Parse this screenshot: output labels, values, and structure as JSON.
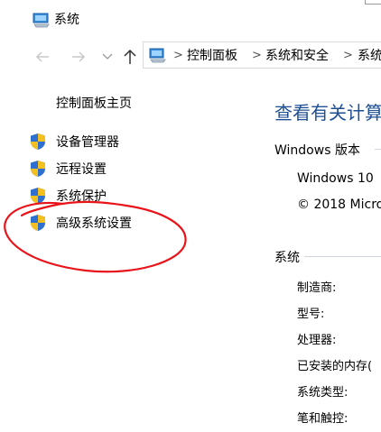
{
  "window": {
    "title": "系统"
  },
  "nav": {
    "back_icon": "arrow-left-icon",
    "forward_icon": "arrow-right-icon",
    "up_icon": "arrow-up-icon",
    "recent_icon": "chevron-down-icon"
  },
  "breadcrumb": {
    "items": [
      "控制面板",
      "系统和安全",
      "系统"
    ],
    "separator": ">"
  },
  "sidebar": {
    "home": "控制面板主页",
    "links": [
      "设备管理器",
      "远程设置",
      "系统保护",
      "高级系统设置"
    ]
  },
  "main": {
    "heading": "查看有关计算",
    "edition_section": "Windows 版本",
    "edition_name": "Windows 10",
    "copyright": "© 2018 Micro",
    "system_section": "系统",
    "rows": [
      "制造商:",
      "型号:",
      "处理器:",
      "已安装的内存(",
      "系统类型:",
      "笔和触控:"
    ]
  },
  "colors": {
    "heading": "#1e4f94",
    "annotation": "#e8141a"
  }
}
